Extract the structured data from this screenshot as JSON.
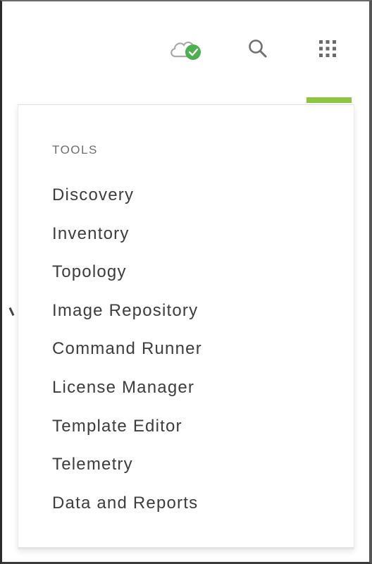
{
  "header": {
    "status_icon": "cloud-check-icon",
    "status_color": "#4caf50",
    "search_icon": "search-icon",
    "apps_icon": "grid-icon",
    "active_indicator_color": "#8cc63f"
  },
  "menu": {
    "section_title": "TOOLS",
    "items": [
      {
        "label": "Discovery"
      },
      {
        "label": "Inventory"
      },
      {
        "label": "Topology"
      },
      {
        "label": "Image Repository"
      },
      {
        "label": "Command Runner"
      },
      {
        "label": "License Manager"
      },
      {
        "label": "Template Editor"
      },
      {
        "label": "Telemetry"
      },
      {
        "label": "Data and Reports"
      }
    ]
  }
}
